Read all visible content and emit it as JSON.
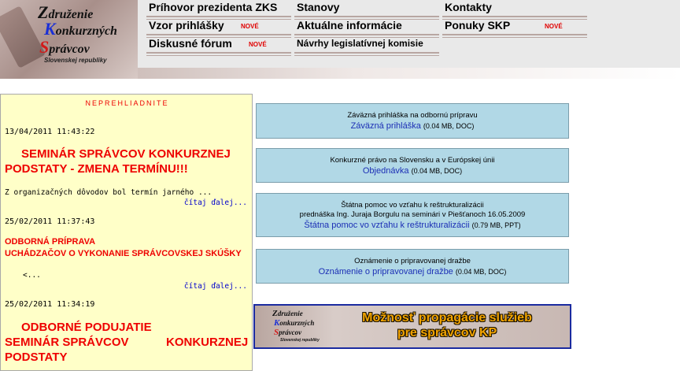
{
  "logo": {
    "line1_initial": "Z",
    "line1_rest": "druženie",
    "line2_initial": "K",
    "line2_rest": "onkurzných",
    "line3_initial": "S",
    "line3_rest": "právcov",
    "subtitle": "Slovenskej republiky"
  },
  "nav": {
    "speech": "Príhovor prezidenta ZKS",
    "statutes": "Stanovy",
    "contacts": "Kontakty",
    "forms": "Vzor prihlášky",
    "forms_badge": "NOVÉ",
    "news": "Aktuálne informácie",
    "offers": "Ponuky SKP",
    "offers_badge": "NOVÉ",
    "forum": "Diskusné fórum",
    "forum_badge": "NOVÉ",
    "legislation": "Návrhy legislatívnej komisie"
  },
  "notice": {
    "title": "NEPREHLIADNITE",
    "items": [
      {
        "date": "13/04/2011 11:43:22",
        "title_line1": "SEMINÁR SPRÁVCOV KONKURZNEJ",
        "title_line2": "PODSTATY - ZMENA TERMÍNU!!!",
        "excerpt": "Z organizačných dôvodov bol termín jarného ...",
        "more": "čítaj ďalej..."
      },
      {
        "date": "25/02/2011 11:37:43",
        "title_line1": "ODBORNÁ PRÍPRAVA",
        "title_line2": "UCHÁDZAČOV O VYKONANIE SPRÁVCOVSKEJ SKÚŠKY",
        "excerpt": "<...",
        "more": "čítaj ďalej..."
      },
      {
        "date": "25/02/2011 11:34:19",
        "title_line1": "ODBORNÉ PODUJATIE",
        "title_line2a": "SEMINÁR SPRÁVCOV",
        "title_line2b": "KONKURZNEJ",
        "title_line3": "PODSTATY"
      }
    ]
  },
  "downloads": [
    {
      "desc": "Záväzná prihláška na odbornú prípravu",
      "link": "Záväzná prihláška",
      "meta": "(0.04 MB, DOC)"
    },
    {
      "desc": "Konkurzné právo na Slovensku a v Európskej únii",
      "link": "Objednávka",
      "meta": "(0.04 MB, DOC)"
    },
    {
      "desc": "Štátna pomoc vo vzťahu k reštrukturalizácii",
      "desc2": "prednáška Ing. Juraja Borgulu na seminári v Piešťanoch 16.05.2009",
      "link": "Štátna pomoc vo vzťahu k reštrukturalizácii",
      "meta": "(0.79 MB, PPT)"
    },
    {
      "desc": "Oznámenie o pripravovanej dražbe",
      "link": "Oznámenie o pripravovanej dražbe",
      "meta": "(0.04 MB, DOC)"
    }
  ],
  "banner": {
    "logo_l1": "druženie",
    "logo_l2": "onkurzných",
    "logo_l3": "právcov",
    "logo_sub": "Slovenskej republiky",
    "line1": "Možnosť propagácie služieb",
    "line2": "pre správcov KP"
  }
}
